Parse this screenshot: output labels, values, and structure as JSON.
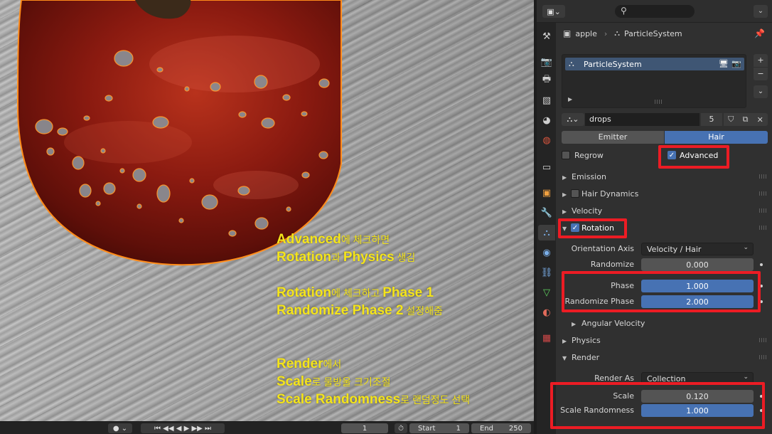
{
  "overlay": {
    "line1_bold": "Advanced",
    "line1_rest": "에 체크하면",
    "line2_bold1": "Rotation",
    "line2_mid": "과 ",
    "line2_bold2": "Physics",
    "line2_rest": " 생김",
    "line3_bold": "Rotation",
    "line3_mid": "에 체크하고 ",
    "line3_bold2": "Phase 1",
    "line4_bold": "Randomize Phase 2",
    "line4_rest": " 설정해줌",
    "line5_bold": "Render",
    "line5_rest": "에서",
    "line6_bold": "Scale",
    "line6_rest": "로 물방울 크기조절",
    "line7_bold": "Scale Randomness",
    "line7_rest": "로 랜덤정도 선택"
  },
  "timeline": {
    "current_frame": "1",
    "start_label": "Start",
    "start_value": "1",
    "end_label": "End",
    "end_value": "250"
  },
  "header": {
    "search_placeholder": ""
  },
  "breadcrumb": {
    "object": "apple",
    "system": "ParticleSystem"
  },
  "particle_list": {
    "items": [
      "ParticleSystem"
    ]
  },
  "settings": {
    "name": "drops",
    "users": "5"
  },
  "type_toggle": {
    "emitter": "Emitter",
    "hair": "Hair",
    "active": "Hair"
  },
  "options": {
    "regrow": "Regrow",
    "regrow_checked": false,
    "advanced": "Advanced",
    "advanced_checked": true
  },
  "sections": {
    "emission": "Emission",
    "hair_dynamics": "Hair Dynamics",
    "velocity": "Velocity",
    "rotation": "Rotation",
    "angular_velocity": "Angular Velocity",
    "physics": "Physics",
    "render": "Render"
  },
  "rotation": {
    "orientation_axis_label": "Orientation Axis",
    "orientation_axis_value": "Velocity / Hair",
    "randomize_label": "Randomize",
    "randomize_value": "0.000",
    "phase_label": "Phase",
    "phase_value": "1.000",
    "randomize_phase_label": "Randomize Phase",
    "randomize_phase_value": "2.000"
  },
  "render": {
    "render_as_label": "Render As",
    "render_as_value": "Collection",
    "scale_label": "Scale",
    "scale_value": "0.120",
    "scale_randomness_label": "Scale Randomness",
    "scale_randomness_value": "1.000"
  },
  "colors": {
    "accent_blue": "#4772b3",
    "highlight_red": "#ec1c24",
    "overlay_yellow": "#f4e41a",
    "apple_red": "#8a1a10",
    "selection_orange": "#ff8c1a"
  }
}
